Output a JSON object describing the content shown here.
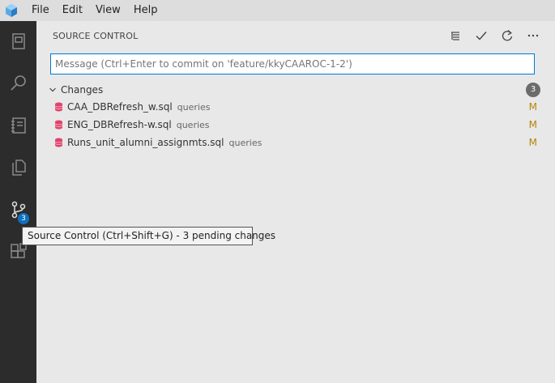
{
  "menubar": {
    "items": [
      "File",
      "Edit",
      "View",
      "Help"
    ]
  },
  "activitybar": {
    "items": [
      {
        "name": "explorer",
        "icon": "explorer-icon"
      },
      {
        "name": "search",
        "icon": "search-icon"
      },
      {
        "name": "notebooks",
        "icon": "notebook-icon"
      },
      {
        "name": "copy",
        "icon": "files-icon"
      },
      {
        "name": "source-control",
        "icon": "source-control-icon",
        "badge": "3"
      },
      {
        "name": "extensions",
        "icon": "extensions-icon"
      }
    ]
  },
  "panel": {
    "title": "SOURCE CONTROL",
    "actions": [
      "list-tree-icon",
      "check-icon",
      "refresh-icon",
      "more-icon"
    ],
    "message_placeholder": "Message (Ctrl+Enter to commit on 'feature/kkyCAAROC-1-2')",
    "changes": {
      "label": "Changes",
      "count": "3",
      "files": [
        {
          "name": "CAA_DBRefresh_w.sql",
          "folder": "queries",
          "status": "M"
        },
        {
          "name": "ENG_DBRefresh-w.sql",
          "folder": "queries",
          "status": "M"
        },
        {
          "name": "Runs_unit_alumni_assignmts.sql",
          "folder": "queries",
          "status": "M"
        }
      ]
    }
  },
  "tooltip": {
    "text": "Source Control (Ctrl+Shift+G) - 3 pending changes"
  },
  "colors": {
    "accent": "#0078d4",
    "badge": "#0e70c0",
    "modified": "#b5860b",
    "db_icon": "#e0436b"
  }
}
